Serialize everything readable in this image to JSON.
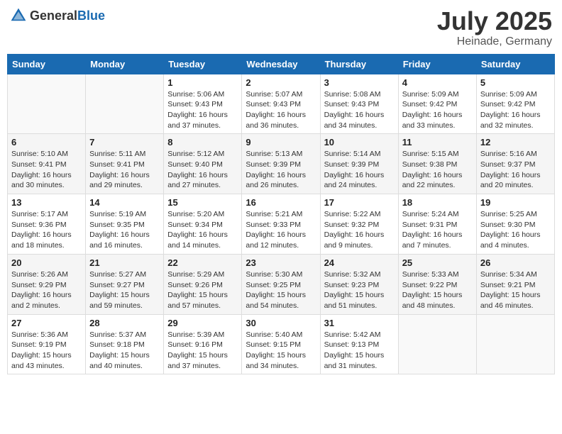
{
  "header": {
    "logo_general": "General",
    "logo_blue": "Blue",
    "month_year": "July 2025",
    "location": "Heinade, Germany"
  },
  "weekdays": [
    "Sunday",
    "Monday",
    "Tuesday",
    "Wednesday",
    "Thursday",
    "Friday",
    "Saturday"
  ],
  "weeks": [
    [
      {
        "day": "",
        "info": ""
      },
      {
        "day": "",
        "info": ""
      },
      {
        "day": "1",
        "info": "Sunrise: 5:06 AM\nSunset: 9:43 PM\nDaylight: 16 hours and 37 minutes."
      },
      {
        "day": "2",
        "info": "Sunrise: 5:07 AM\nSunset: 9:43 PM\nDaylight: 16 hours and 36 minutes."
      },
      {
        "day": "3",
        "info": "Sunrise: 5:08 AM\nSunset: 9:43 PM\nDaylight: 16 hours and 34 minutes."
      },
      {
        "day": "4",
        "info": "Sunrise: 5:09 AM\nSunset: 9:42 PM\nDaylight: 16 hours and 33 minutes."
      },
      {
        "day": "5",
        "info": "Sunrise: 5:09 AM\nSunset: 9:42 PM\nDaylight: 16 hours and 32 minutes."
      }
    ],
    [
      {
        "day": "6",
        "info": "Sunrise: 5:10 AM\nSunset: 9:41 PM\nDaylight: 16 hours and 30 minutes."
      },
      {
        "day": "7",
        "info": "Sunrise: 5:11 AM\nSunset: 9:41 PM\nDaylight: 16 hours and 29 minutes."
      },
      {
        "day": "8",
        "info": "Sunrise: 5:12 AM\nSunset: 9:40 PM\nDaylight: 16 hours and 27 minutes."
      },
      {
        "day": "9",
        "info": "Sunrise: 5:13 AM\nSunset: 9:39 PM\nDaylight: 16 hours and 26 minutes."
      },
      {
        "day": "10",
        "info": "Sunrise: 5:14 AM\nSunset: 9:39 PM\nDaylight: 16 hours and 24 minutes."
      },
      {
        "day": "11",
        "info": "Sunrise: 5:15 AM\nSunset: 9:38 PM\nDaylight: 16 hours and 22 minutes."
      },
      {
        "day": "12",
        "info": "Sunrise: 5:16 AM\nSunset: 9:37 PM\nDaylight: 16 hours and 20 minutes."
      }
    ],
    [
      {
        "day": "13",
        "info": "Sunrise: 5:17 AM\nSunset: 9:36 PM\nDaylight: 16 hours and 18 minutes."
      },
      {
        "day": "14",
        "info": "Sunrise: 5:19 AM\nSunset: 9:35 PM\nDaylight: 16 hours and 16 minutes."
      },
      {
        "day": "15",
        "info": "Sunrise: 5:20 AM\nSunset: 9:34 PM\nDaylight: 16 hours and 14 minutes."
      },
      {
        "day": "16",
        "info": "Sunrise: 5:21 AM\nSunset: 9:33 PM\nDaylight: 16 hours and 12 minutes."
      },
      {
        "day": "17",
        "info": "Sunrise: 5:22 AM\nSunset: 9:32 PM\nDaylight: 16 hours and 9 minutes."
      },
      {
        "day": "18",
        "info": "Sunrise: 5:24 AM\nSunset: 9:31 PM\nDaylight: 16 hours and 7 minutes."
      },
      {
        "day": "19",
        "info": "Sunrise: 5:25 AM\nSunset: 9:30 PM\nDaylight: 16 hours and 4 minutes."
      }
    ],
    [
      {
        "day": "20",
        "info": "Sunrise: 5:26 AM\nSunset: 9:29 PM\nDaylight: 16 hours and 2 minutes."
      },
      {
        "day": "21",
        "info": "Sunrise: 5:27 AM\nSunset: 9:27 PM\nDaylight: 15 hours and 59 minutes."
      },
      {
        "day": "22",
        "info": "Sunrise: 5:29 AM\nSunset: 9:26 PM\nDaylight: 15 hours and 57 minutes."
      },
      {
        "day": "23",
        "info": "Sunrise: 5:30 AM\nSunset: 9:25 PM\nDaylight: 15 hours and 54 minutes."
      },
      {
        "day": "24",
        "info": "Sunrise: 5:32 AM\nSunset: 9:23 PM\nDaylight: 15 hours and 51 minutes."
      },
      {
        "day": "25",
        "info": "Sunrise: 5:33 AM\nSunset: 9:22 PM\nDaylight: 15 hours and 48 minutes."
      },
      {
        "day": "26",
        "info": "Sunrise: 5:34 AM\nSunset: 9:21 PM\nDaylight: 15 hours and 46 minutes."
      }
    ],
    [
      {
        "day": "27",
        "info": "Sunrise: 5:36 AM\nSunset: 9:19 PM\nDaylight: 15 hours and 43 minutes."
      },
      {
        "day": "28",
        "info": "Sunrise: 5:37 AM\nSunset: 9:18 PM\nDaylight: 15 hours and 40 minutes."
      },
      {
        "day": "29",
        "info": "Sunrise: 5:39 AM\nSunset: 9:16 PM\nDaylight: 15 hours and 37 minutes."
      },
      {
        "day": "30",
        "info": "Sunrise: 5:40 AM\nSunset: 9:15 PM\nDaylight: 15 hours and 34 minutes."
      },
      {
        "day": "31",
        "info": "Sunrise: 5:42 AM\nSunset: 9:13 PM\nDaylight: 15 hours and 31 minutes."
      },
      {
        "day": "",
        "info": ""
      },
      {
        "day": "",
        "info": ""
      }
    ]
  ]
}
